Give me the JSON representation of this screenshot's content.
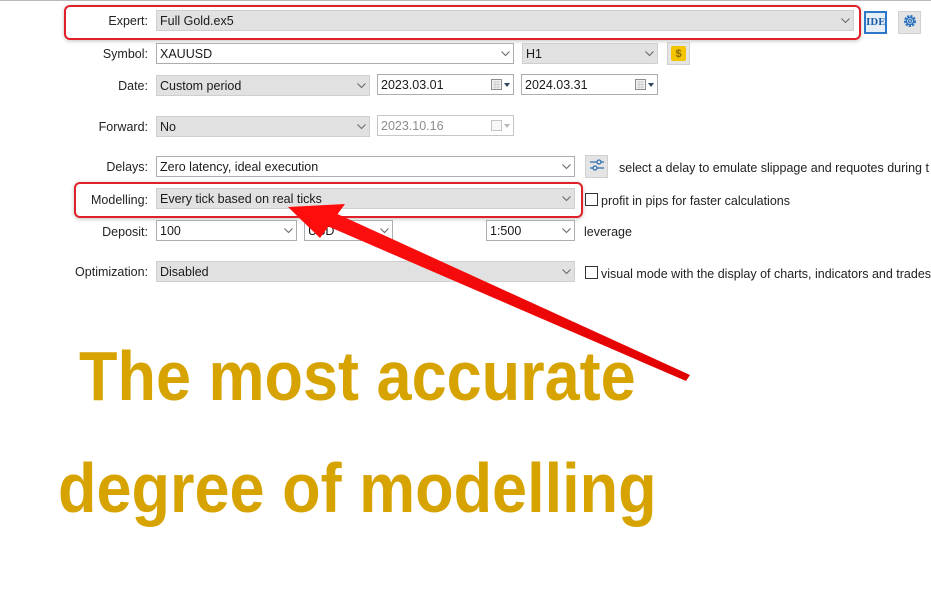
{
  "form": {
    "expert": {
      "label": "Expert:",
      "value": "Full Gold.ex5"
    },
    "ide_button": {
      "label": "IDE"
    },
    "settings_button": {
      "icon": "gear-icon"
    },
    "symbol": {
      "label": "Symbol:",
      "value": "XAUUSD"
    },
    "timeframe": {
      "value": "H1"
    },
    "symbol_props_button": {
      "icon": "dollar-icon",
      "glyph": "$"
    },
    "date": {
      "label": "Date:",
      "value": "Custom period",
      "from": "2023.03.01",
      "to": "2024.03.31"
    },
    "forward": {
      "label": "Forward:",
      "value": "No",
      "date": "2023.10.16"
    },
    "delays": {
      "label": "Delays:",
      "value": "Zero latency, ideal execution",
      "note": "select a delay to emulate slippage and requotes during t"
    },
    "modelling": {
      "label": "Modelling:",
      "value": "Every tick based on real ticks",
      "checkbox_label": "profit in pips for faster calculations",
      "checked": false
    },
    "deposit": {
      "label": "Deposit:",
      "value": "100",
      "currency": "USD",
      "leverage": "1:500",
      "leverage_label": "leverage"
    },
    "optimization": {
      "label": "Optimization:",
      "value": "Disabled",
      "checkbox_label": "visual mode with the display of charts, indicators and trades",
      "checked": false
    }
  },
  "annotation": {
    "line1": "The most accurate",
    "line2": "degree of modelling",
    "text_color": "#d6a300",
    "highlight_color": "#e2202a"
  }
}
